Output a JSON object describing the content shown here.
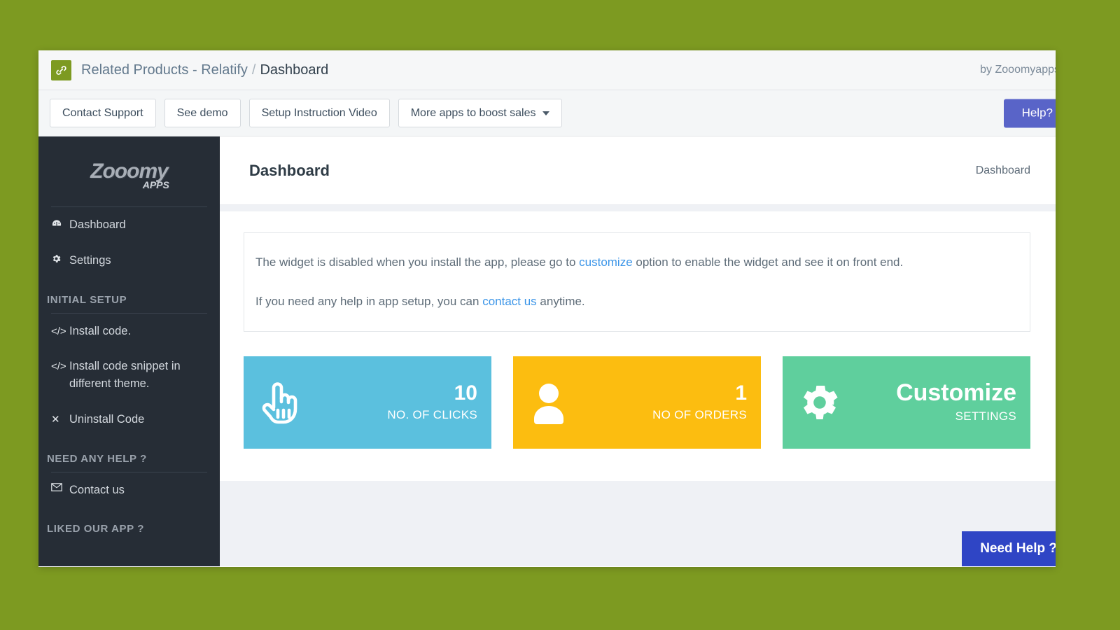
{
  "theme": {
    "page_background": "#7d9a21",
    "sidebar_background": "#262d36",
    "accent_blue": "#5964c8",
    "need_help_blue": "#2f45c5",
    "link_blue": "#3b95e8",
    "card_clicks_color": "#5bc0de",
    "card_orders_color": "#fcbd10",
    "card_customize_color": "#5fcf9d"
  },
  "appbar": {
    "icon": "link-chain-icon",
    "app_name": "Related Products - Relatify",
    "separator": "/",
    "section": "Dashboard",
    "byline": "by Zooomyapps"
  },
  "toolbar": {
    "buttons": [
      {
        "label": "Contact Support",
        "name": "contact-support-button"
      },
      {
        "label": "See demo",
        "name": "see-demo-button"
      },
      {
        "label": "Setup Instruction Video",
        "name": "setup-instruction-video-button"
      },
      {
        "label": "More apps to boost sales",
        "name": "more-apps-dropdown",
        "caret": true
      }
    ],
    "help_label": "Help?"
  },
  "sidebar": {
    "logo_text": "Zooomy",
    "logo_suffix": "APPS",
    "items": [
      {
        "label": "Dashboard",
        "icon": "dashboard-gauge-icon"
      },
      {
        "label": "Settings",
        "icon": "gear-icon"
      }
    ],
    "initial_setup_heading": "INITIAL SETUP",
    "setup_items": [
      {
        "label": "Install code.",
        "icon": "code-icon"
      },
      {
        "label": "Install code snippet in different theme.",
        "icon": "code-icon"
      },
      {
        "label": "Uninstall Code",
        "icon": "close-x-icon"
      }
    ],
    "need_help_heading": "NEED ANY HELP ?",
    "help_items": [
      {
        "label": "Contact us",
        "icon": "envelope-icon"
      }
    ],
    "liked_heading": "LIKED OUR APP ?"
  },
  "main": {
    "page_title": "Dashboard",
    "breadcrumb": "Dashboard",
    "info": {
      "line1_part1": "The widget is disabled when you install the app, please go to ",
      "line1_link": "customize",
      "line1_part2": " option to enable the widget and see it on front end.",
      "line2_part1": "If you need any help in app setup, you can ",
      "line2_link": "contact us",
      "line2_part2": " anytime."
    },
    "cards": [
      {
        "value": "10",
        "label": "NO. OF CLICKS",
        "icon": "pointing-hand-icon",
        "color": "#5bc0de"
      },
      {
        "value": "1",
        "label": "NO OF ORDERS",
        "icon": "user-icon",
        "color": "#fcbd10"
      },
      {
        "value": "Customize",
        "label": "SETTINGS",
        "icon": "gear-icon",
        "color": "#5fcf9d"
      }
    ],
    "need_help_button": "Need Help ?"
  }
}
